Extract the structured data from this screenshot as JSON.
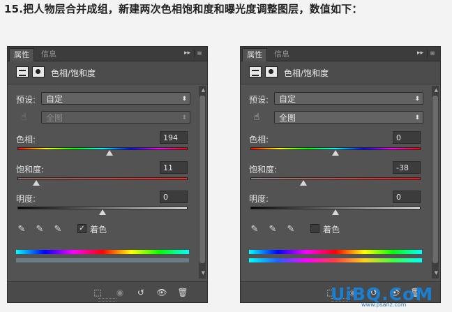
{
  "heading": "15.把人物层合并成组，新建两次色相饱和度和曝光度调整图层，数值如下：",
  "panels": [
    {
      "tabs": [
        "属性",
        "信息"
      ],
      "header_title": "色相/饱和度",
      "preset_label": "预设:",
      "preset_value": "自定",
      "range_value": "全图",
      "range_disabled": true,
      "hue_label": "色相:",
      "hue_value": "194",
      "hue_fraction": 0.54,
      "saturation_label": "饱和度:",
      "saturation_value": "11",
      "saturation_fraction": 0.11,
      "lightness_label": "明度:",
      "lightness_value": "0",
      "lightness_fraction": 0.5,
      "colorize_label": "着色",
      "colorize_checked": true,
      "check_mark": "✓"
    },
    {
      "tabs": [
        "属性",
        "信息"
      ],
      "header_title": "色相/饱和度",
      "preset_label": "预设:",
      "preset_value": "自定",
      "range_value": "全图",
      "range_disabled": false,
      "hue_label": "色相:",
      "hue_value": "0",
      "hue_fraction": 0.5,
      "saturation_label": "饱和度:",
      "saturation_value": "-38",
      "saturation_fraction": 0.31,
      "lightness_label": "明度:",
      "lightness_value": "0",
      "lightness_fraction": 0.5,
      "colorize_label": "着色",
      "colorize_checked": false,
      "check_mark": ""
    }
  ],
  "icons": {
    "arrows": "▸▸",
    "menu": "≡",
    "hand": "☝",
    "dropper": "✎",
    "select_arrows": "⬍",
    "clip": "⬚",
    "eye_prev": "◉",
    "reset": "↺",
    "eye": "👁",
    "trash": "🗑"
  },
  "watermark": "UiBQ.CoM",
  "watermark_sub": "www.psahz.com"
}
